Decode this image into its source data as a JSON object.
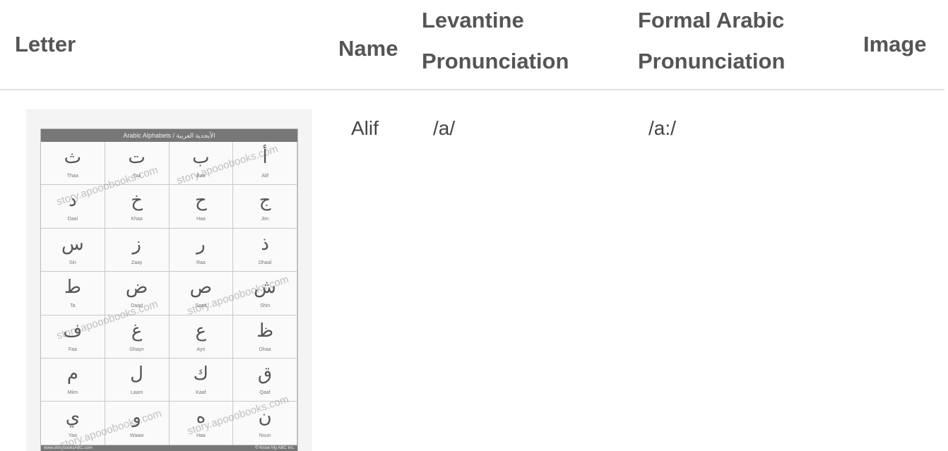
{
  "table": {
    "headers": {
      "letter": "Letter",
      "name": "Name",
      "levantine_1": "Levantine",
      "levantine_2": "Pronunciation",
      "formal_1": "Formal Arabic",
      "formal_2": "Pronunciation",
      "image": "Image"
    },
    "row": {
      "name": "Alif",
      "levantine": "/a/",
      "formal": "/a:/"
    }
  },
  "chart_image": {
    "title": "Arabic Alphabets / الأبجدية العربية",
    "footer_left": "www.storybooksABC.com",
    "footer_right": "© Know My ABC Inc.",
    "watermark": "story.apooobooks.com",
    "cells": [
      {
        "g": "ث",
        "n": "Thaa"
      },
      {
        "g": "ت",
        "n": "Taa"
      },
      {
        "g": "ب",
        "n": "Baa"
      },
      {
        "g": "أ",
        "n": "Alif"
      },
      {
        "g": "د",
        "n": "Daal"
      },
      {
        "g": "خ",
        "n": "Khaa"
      },
      {
        "g": "ح",
        "n": "Haa"
      },
      {
        "g": "ج",
        "n": "Jim"
      },
      {
        "g": "س",
        "n": "Sin"
      },
      {
        "g": "ز",
        "n": "Zaay"
      },
      {
        "g": "ر",
        "n": "Raa"
      },
      {
        "g": "ذ",
        "n": "Dhaal"
      },
      {
        "g": "ط",
        "n": "Ta"
      },
      {
        "g": "ض",
        "n": "Daad"
      },
      {
        "g": "ص",
        "n": "Saad"
      },
      {
        "g": "ش",
        "n": "Shin"
      },
      {
        "g": "ف",
        "n": "Faa"
      },
      {
        "g": "غ",
        "n": "Ghayn"
      },
      {
        "g": "ع",
        "n": "Ayn"
      },
      {
        "g": "ظ",
        "n": "Dhaa"
      },
      {
        "g": "م",
        "n": "Miim"
      },
      {
        "g": "ل",
        "n": "Laam"
      },
      {
        "g": "ك",
        "n": "Kaaf"
      },
      {
        "g": "ق",
        "n": "Qaaf"
      },
      {
        "g": "ي",
        "n": "Yaa"
      },
      {
        "g": "و",
        "n": "Waaw"
      },
      {
        "g": "ه",
        "n": "Haa"
      },
      {
        "g": "ن",
        "n": "Nuun"
      }
    ]
  }
}
